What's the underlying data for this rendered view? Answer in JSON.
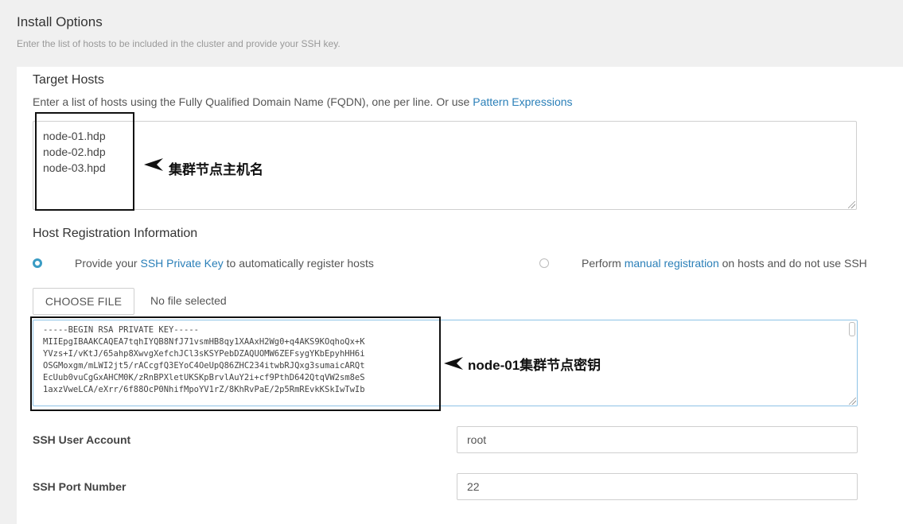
{
  "page": {
    "title": "Install Options",
    "subtitle": "Enter the list of hosts to be included in the cluster and provide your SSH key."
  },
  "target_hosts": {
    "title": "Target Hosts",
    "hint_prefix": "Enter a list of hosts using the Fully Qualified Domain Name (FQDN), one per line. Or use ",
    "hint_link": "Pattern Expressions",
    "hosts": [
      "node-01.hdp",
      "node-02.hdp",
      "node-03.hpd"
    ]
  },
  "registration": {
    "title": "Host Registration Information",
    "option_ssh": {
      "prefix": "Provide your ",
      "link": "SSH Private Key",
      "suffix": " to automatically register hosts",
      "selected": true
    },
    "option_manual": {
      "prefix": "Perform ",
      "link": "manual registration",
      "suffix": " on hosts and do not use SSH",
      "selected": false
    },
    "choose_file_label": "CHOOSE FILE",
    "file_status": "No file selected",
    "key_lines": [
      "-----BEGIN RSA PRIVATE KEY-----",
      "MIIEpgIBAAKCAQEA7tqhIYQB8NfJ71vsmHB8qy1XAAxH2Wg0+q4AKS9KOqhoQx+K",
      "YVzs+I/vKtJ/65ahp8XwvgXefchJCl3sKSYPebDZAQUOMW6ZEFsygYKbEpyhHH6i",
      "OSGMoxgm/mLWI2jt5/rACcgfQ3EYoC4OeUpQ86ZHC234itwbRJQxg3sumaicARQt",
      "EcUub0vuCgGxAHCM0K/zRnBPXletUKSKpBrvlAuY2i+cf9PthD642QtqVW2sm8eS",
      "1axzVweLCA/eXrr/6f88OcP0NhifMpoYV1rZ/8KhRvPaE/2p5RmREvkKSkIwTwIb"
    ]
  },
  "ssh_user": {
    "label": "SSH User Account",
    "value": "root"
  },
  "ssh_port": {
    "label": "SSH Port Number",
    "value": "22"
  },
  "annotations": {
    "hosts_note": "集群节点主机名",
    "key_note": "node-01集群节点密钥"
  },
  "colors": {
    "link": "#2a7fb8",
    "radio_selected": "#3a9cc4",
    "focus_border": "#8ec3e6",
    "annotation": "#111111"
  }
}
